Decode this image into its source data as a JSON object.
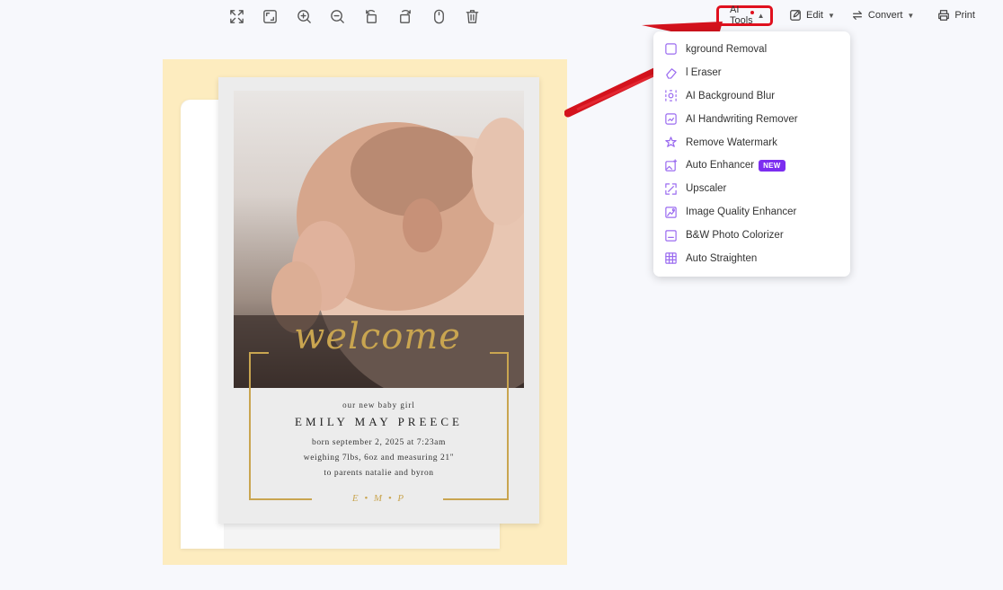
{
  "toolbar": {
    "view_icons": [
      "fit-screen-icon",
      "fullscreen-icon",
      "zoom-in-icon",
      "zoom-out-icon",
      "rotate-left-icon",
      "rotate-right-icon",
      "mouse-icon",
      "trash-icon"
    ]
  },
  "right_toolbar": {
    "ai_tools_label": "AI Tools",
    "edit_label": "Edit",
    "convert_label": "Convert",
    "print_label": "Print"
  },
  "ai_menu": {
    "items": [
      {
        "label": "kground Removal",
        "icon": "background-removal-icon"
      },
      {
        "label": "l Eraser",
        "icon": "eraser-icon"
      },
      {
        "label": "AI Background Blur",
        "icon": "blur-icon"
      },
      {
        "label": "AI Handwriting Remover",
        "icon": "handwriting-icon"
      },
      {
        "label": "Remove Watermark",
        "icon": "watermark-icon"
      },
      {
        "label": "Auto Enhancer",
        "icon": "enhancer-icon",
        "badge": "NEW"
      },
      {
        "label": "Upscaler",
        "icon": "upscaler-icon"
      },
      {
        "label": "Image Quality Enhancer",
        "icon": "quality-icon"
      },
      {
        "label": "B&W Photo Colorizer",
        "icon": "colorizer-icon"
      },
      {
        "label": "Auto Straighten",
        "icon": "straighten-icon"
      }
    ]
  },
  "card": {
    "welcome": "welcome",
    "line1": "our new baby girl",
    "name": "EMILY MAY PREECE",
    "line3": "born september 2, 2025 at 7:23am",
    "line4": "weighing 7lbs, 6oz and measuring 21\"",
    "line5": "to parents natalie and byron",
    "initials": "E • M • P"
  },
  "colors": {
    "accent_purple": "#7c2df0",
    "highlight_red": "#e0101e",
    "gold": "#c9a550",
    "doc_background": "#fdecbf"
  }
}
